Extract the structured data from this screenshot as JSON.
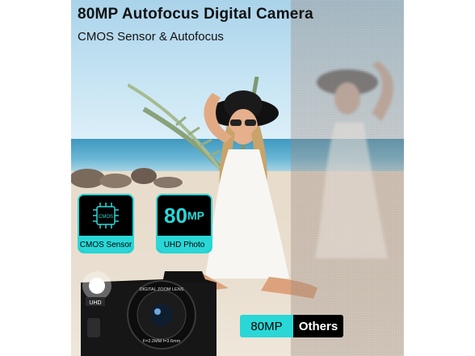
{
  "headline": "80MP Autofocus Digital Camera",
  "subline": "CMOS Sensor & Autofocus",
  "features": [
    {
      "chip_text": "CMOS",
      "label": "CMOS Sensor"
    },
    {
      "value": "80",
      "unit": "MP",
      "label": "UHD Photo"
    }
  ],
  "camera": {
    "badge": "UHD",
    "ring_text": "DIGITAL ZOOM LENS",
    "lens_spec": "F=2.2MM f=3.6mm"
  },
  "compare": {
    "ours": "80MP",
    "theirs": "Others"
  },
  "colors": {
    "accent": "#2ad7d7",
    "dark": "#000000"
  }
}
